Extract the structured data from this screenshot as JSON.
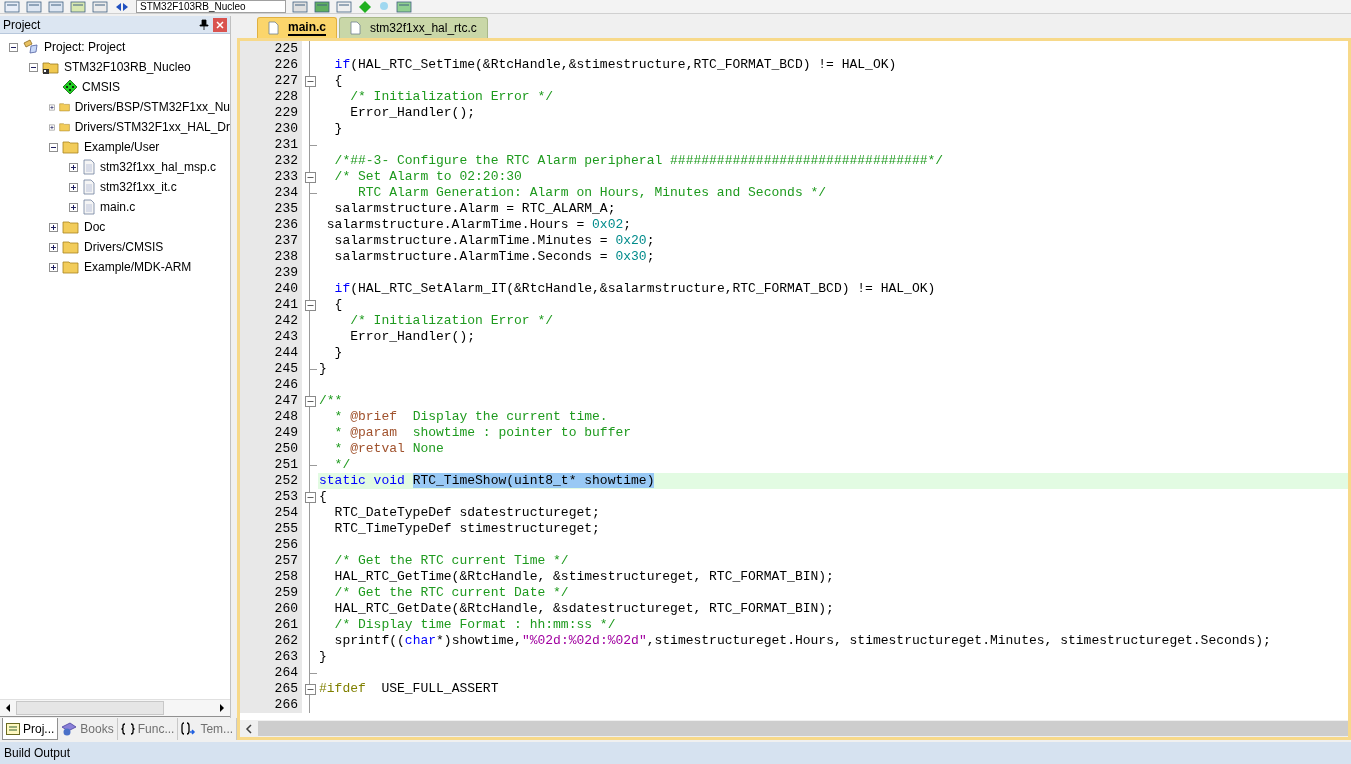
{
  "toolbar": {
    "target": "STM32F103RB_Nucleo"
  },
  "project_panel": {
    "title": "Project",
    "tree": [
      {
        "label": "Project: Project",
        "kind": "project",
        "expanded": true,
        "children": [
          {
            "label": "STM32F103RB_Nucleo",
            "kind": "target",
            "expanded": true,
            "children": [
              {
                "label": "CMSIS",
                "kind": "component"
              },
              {
                "label": "Drivers/BSP/STM32F1xx_Nu",
                "kind": "folder",
                "expanded": false
              },
              {
                "label": "Drivers/STM32F1xx_HAL_Dr",
                "kind": "folder",
                "expanded": false
              },
              {
                "label": "Example/User",
                "kind": "folder",
                "expanded": true,
                "children": [
                  {
                    "label": "stm32f1xx_hal_msp.c",
                    "kind": "file",
                    "expanded": false
                  },
                  {
                    "label": "stm32f1xx_it.c",
                    "kind": "file",
                    "expanded": false
                  },
                  {
                    "label": "main.c",
                    "kind": "file",
                    "expanded": false
                  }
                ]
              },
              {
                "label": "Doc",
                "kind": "folder",
                "expanded": false
              },
              {
                "label": "Drivers/CMSIS",
                "kind": "folder",
                "expanded": false
              },
              {
                "label": "Example/MDK-ARM",
                "kind": "folder",
                "expanded": false
              }
            ]
          }
        ]
      }
    ],
    "tabs": [
      {
        "label": "Proj...",
        "kind": "project",
        "selected": true
      },
      {
        "label": "Books",
        "kind": "books",
        "selected": false
      },
      {
        "label": "Func...",
        "kind": "functions",
        "selected": false
      },
      {
        "label": "Tem...",
        "kind": "templates",
        "selected": false
      }
    ]
  },
  "editor": {
    "tabs": [
      {
        "label": "main.c",
        "selected": true
      },
      {
        "label": "stm32f1xx_hal_rtc.c",
        "selected": false
      }
    ],
    "lines": [
      {
        "number": "225",
        "fold_open": false,
        "fold_end": false,
        "current": false
      },
      {
        "number": "226",
        "fold_open": false,
        "fold_end": false,
        "current": false,
        "tokens": [
          {
            "kind": "keyword",
            "text": "  if"
          },
          {
            "kind": "plain",
            "text": "(HAL_RTC_SetTime(&RtcHandle,&stimestructure,RTC_FORMAT_BCD) != HAL_OK)"
          }
        ]
      },
      {
        "number": "227",
        "fold_open": true,
        "fold_end": false,
        "current": false,
        "tokens": [
          {
            "kind": "plain",
            "text": "  {"
          }
        ]
      },
      {
        "number": "228",
        "fold_open": false,
        "fold_end": false,
        "current": false,
        "tokens": [
          {
            "kind": "comment",
            "text": "    /* Initialization Error */"
          }
        ]
      },
      {
        "number": "229",
        "fold_open": false,
        "fold_end": false,
        "current": false,
        "tokens": [
          {
            "kind": "plain",
            "text": "    Error_Handler();"
          }
        ]
      },
      {
        "number": "230",
        "fold_open": false,
        "fold_end": false,
        "current": false,
        "tokens": [
          {
            "kind": "plain",
            "text": "  }"
          }
        ]
      },
      {
        "number": "231",
        "fold_open": false,
        "fold_end": true,
        "current": false
      },
      {
        "number": "232",
        "fold_open": false,
        "fold_end": false,
        "current": false,
        "tokens": [
          {
            "kind": "comment",
            "text": "  /*##-3- Configure the RTC Alarm peripheral #################################*/"
          }
        ]
      },
      {
        "number": "233",
        "fold_open": true,
        "fold_end": false,
        "current": false,
        "tokens": [
          {
            "kind": "comment",
            "text": "  /* Set Alarm to 02:20:30"
          }
        ]
      },
      {
        "number": "234",
        "fold_open": false,
        "fold_end": true,
        "current": false,
        "tokens": [
          {
            "kind": "comment",
            "text": "     RTC Alarm Generation: Alarm on Hours, Minutes and Seconds */"
          }
        ]
      },
      {
        "number": "235",
        "fold_open": false,
        "fold_end": false,
        "current": false,
        "tokens": [
          {
            "kind": "plain",
            "text": "  salarmstructure.Alarm = RTC_ALARM_A;"
          }
        ]
      },
      {
        "number": "236",
        "fold_open": false,
        "fold_end": false,
        "current": false,
        "tokens": [
          {
            "kind": "plain",
            "text": " salarmstructure.AlarmTime.Hours = "
          },
          {
            "kind": "number",
            "text": "0x02"
          },
          {
            "kind": "plain",
            "text": ";"
          }
        ]
      },
      {
        "number": "237",
        "fold_open": false,
        "fold_end": false,
        "current": false,
        "tokens": [
          {
            "kind": "plain",
            "text": "  salarmstructure.AlarmTime.Minutes = "
          },
          {
            "kind": "number",
            "text": "0x20"
          },
          {
            "kind": "plain",
            "text": ";"
          }
        ]
      },
      {
        "number": "238",
        "fold_open": false,
        "fold_end": false,
        "current": false,
        "tokens": [
          {
            "kind": "plain",
            "text": "  salarmstructure.AlarmTime.Seconds = "
          },
          {
            "kind": "number",
            "text": "0x30"
          },
          {
            "kind": "plain",
            "text": ";"
          }
        ]
      },
      {
        "number": "239",
        "fold_open": false,
        "fold_end": false,
        "current": false
      },
      {
        "number": "240",
        "fold_open": false,
        "fold_end": false,
        "current": false,
        "tokens": [
          {
            "kind": "keyword",
            "text": "  if"
          },
          {
            "kind": "plain",
            "text": "(HAL_RTC_SetAlarm_IT(&RtcHandle,&salarmstructure,RTC_FORMAT_BCD) != HAL_OK)"
          }
        ]
      },
      {
        "number": "241",
        "fold_open": true,
        "fold_end": false,
        "current": false,
        "tokens": [
          {
            "kind": "plain",
            "text": "  {"
          }
        ]
      },
      {
        "number": "242",
        "fold_open": false,
        "fold_end": false,
        "current": false,
        "tokens": [
          {
            "kind": "comment",
            "text": "    /* Initialization Error */"
          }
        ]
      },
      {
        "number": "243",
        "fold_open": false,
        "fold_end": false,
        "current": false,
        "tokens": [
          {
            "kind": "plain",
            "text": "    Error_Handler();"
          }
        ]
      },
      {
        "number": "244",
        "fold_open": false,
        "fold_end": false,
        "current": false,
        "tokens": [
          {
            "kind": "plain",
            "text": "  }"
          }
        ]
      },
      {
        "number": "245",
        "fold_open": false,
        "fold_end": true,
        "current": false,
        "tokens": [
          {
            "kind": "plain",
            "text": "}"
          }
        ]
      },
      {
        "number": "246",
        "fold_open": false,
        "fold_end": false,
        "current": false
      },
      {
        "number": "247",
        "fold_open": true,
        "fold_end": false,
        "current": false,
        "tokens": [
          {
            "kind": "comment",
            "text": "/**"
          }
        ]
      },
      {
        "number": "248",
        "fold_open": false,
        "fold_end": false,
        "current": false,
        "tokens": [
          {
            "kind": "comment",
            "text": "  * "
          },
          {
            "kind": "doctag",
            "text": "@brief"
          },
          {
            "kind": "comment",
            "text": "  Display the current time."
          }
        ]
      },
      {
        "number": "249",
        "fold_open": false,
        "fold_end": false,
        "current": false,
        "tokens": [
          {
            "kind": "comment",
            "text": "  * "
          },
          {
            "kind": "doctag",
            "text": "@param"
          },
          {
            "kind": "comment",
            "text": "  showtime : pointer to buffer"
          }
        ]
      },
      {
        "number": "250",
        "fold_open": false,
        "fold_end": false,
        "current": false,
        "tokens": [
          {
            "kind": "comment",
            "text": "  * "
          },
          {
            "kind": "doctag",
            "text": "@retval"
          },
          {
            "kind": "comment",
            "text": " None"
          }
        ]
      },
      {
        "number": "251",
        "fold_open": false,
        "fold_end": true,
        "current": false,
        "tokens": [
          {
            "kind": "comment",
            "text": "  */"
          }
        ]
      },
      {
        "number": "252",
        "fold_open": false,
        "fold_end": false,
        "current": true,
        "tokens": [
          {
            "kind": "keyword",
            "text": "static void "
          },
          {
            "kind": "selection",
            "text": "RTC_TimeShow(uint8_t* showtime)"
          }
        ]
      },
      {
        "number": "253",
        "fold_open": true,
        "fold_end": false,
        "current": false,
        "tokens": [
          {
            "kind": "plain",
            "text": "{"
          }
        ]
      },
      {
        "number": "254",
        "fold_open": false,
        "fold_end": false,
        "current": false,
        "tokens": [
          {
            "kind": "plain",
            "text": "  RTC_DateTypeDef sdatestructureget;"
          }
        ]
      },
      {
        "number": "255",
        "fold_open": false,
        "fold_end": false,
        "current": false,
        "tokens": [
          {
            "kind": "plain",
            "text": "  RTC_TimeTypeDef stimestructureget;"
          }
        ]
      },
      {
        "number": "256",
        "fold_open": false,
        "fold_end": false,
        "current": false
      },
      {
        "number": "257",
        "fold_open": false,
        "fold_end": false,
        "current": false,
        "tokens": [
          {
            "kind": "comment",
            "text": "  /* Get the RTC current Time */"
          }
        ]
      },
      {
        "number": "258",
        "fold_open": false,
        "fold_end": false,
        "current": false,
        "tokens": [
          {
            "kind": "plain",
            "text": "  HAL_RTC_GetTime(&RtcHandle, &stimestructureget, RTC_FORMAT_BIN);"
          }
        ]
      },
      {
        "number": "259",
        "fold_open": false,
        "fold_end": false,
        "current": false,
        "tokens": [
          {
            "kind": "comment",
            "text": "  /* Get the RTC current Date */"
          }
        ]
      },
      {
        "number": "260",
        "fold_open": false,
        "fold_end": false,
        "current": false,
        "tokens": [
          {
            "kind": "plain",
            "text": "  HAL_RTC_GetDate(&RtcHandle, &sdatestructureget, RTC_FORMAT_BIN);"
          }
        ]
      },
      {
        "number": "261",
        "fold_open": false,
        "fold_end": false,
        "current": false,
        "tokens": [
          {
            "kind": "comment",
            "text": "  /* Display time Format : hh:mm:ss */"
          }
        ]
      },
      {
        "number": "262",
        "fold_open": false,
        "fold_end": false,
        "current": false,
        "tokens": [
          {
            "kind": "plain",
            "text": "  sprintf(("
          },
          {
            "kind": "keyword",
            "text": "char"
          },
          {
            "kind": "plain",
            "text": "*)showtime,"
          },
          {
            "kind": "string",
            "text": "\"%02d:%02d:%02d\""
          },
          {
            "kind": "plain",
            "text": ",stimestructureget.Hours, stimestructureget.Minutes, stimestructureget.Seconds);"
          }
        ]
      },
      {
        "number": "263",
        "fold_open": false,
        "fold_end": false,
        "current": false,
        "tokens": [
          {
            "kind": "plain",
            "text": "}"
          }
        ]
      },
      {
        "number": "264",
        "fold_open": false,
        "fold_end": true,
        "current": false
      },
      {
        "number": "265",
        "fold_open": true,
        "fold_end": false,
        "current": false,
        "tokens": [
          {
            "kind": "preproc",
            "text": "#ifdef"
          },
          {
            "kind": "plain",
            "text": "  USE_FULL_ASSERT"
          }
        ]
      },
      {
        "number": "266",
        "fold_open": false,
        "fold_end": false,
        "current": false
      }
    ]
  },
  "build_output": {
    "title": "Build Output"
  }
}
